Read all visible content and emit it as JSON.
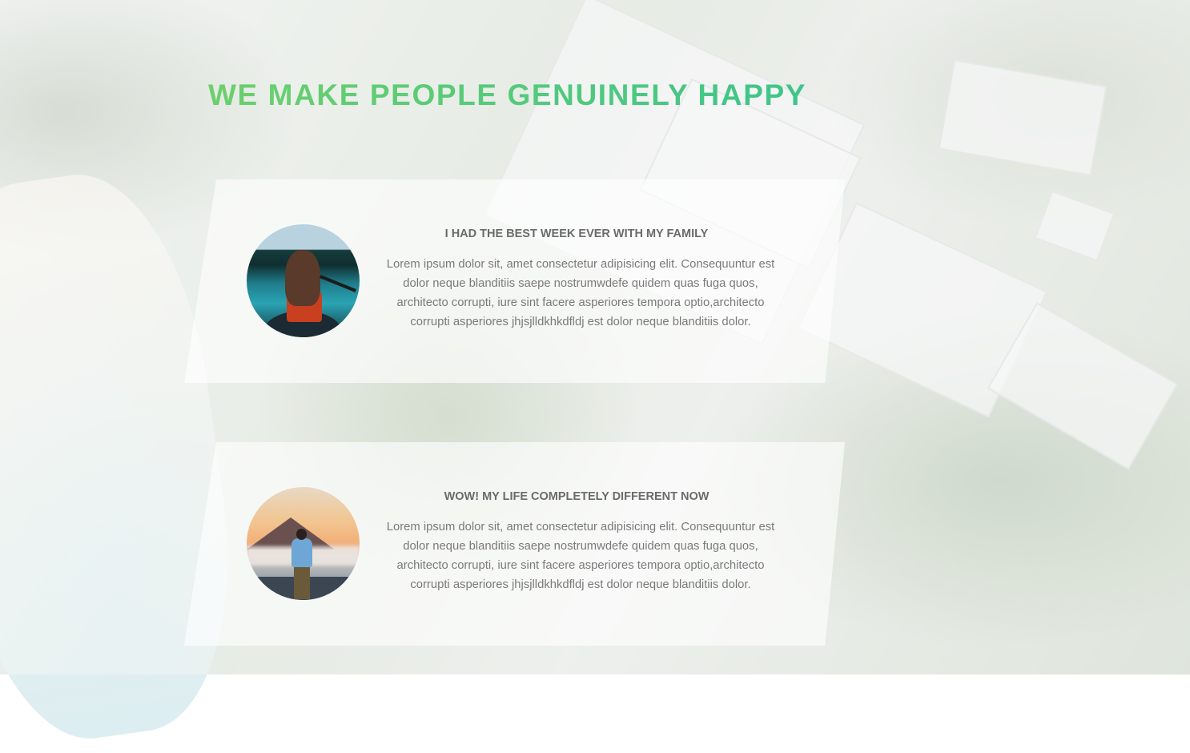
{
  "headline": "WE MAKE PEOPLE GENUINELY HAPPY",
  "testimonials": [
    {
      "title": "I HAD THE BEST WEEK EVER WITH MY FAMILY",
      "text": "Lorem ipsum dolor sit, amet consectetur adipisicing elit. Consequuntur est dolor neque blanditiis saepe nostrumwdefe quidem quas fuga quos, architecto corrupti, iure sint facere asperiores tempora optio,architecto corrupti asperiores jhjsjlldkhkdfldj est dolor neque blanditiis dolor."
    },
    {
      "title": "WOW! MY LIFE COMPLETELY DIFFERENT NOW",
      "text": "Lorem ipsum dolor sit, amet consectetur adipisicing elit. Consequuntur est dolor neque blanditiis saepe nostrumwdefe quidem quas fuga quos, architecto corrupti, iure sint facere asperiores tempora optio,architecto corrupti asperiores jhjsjlldkhkdfldj est dolor neque blanditiis dolor."
    }
  ],
  "colors": {
    "headline_gradient_start": "#6ccf6c",
    "headline_gradient_end": "#3ec58a",
    "card_title": "#6b6b6b",
    "card_text": "#7a7a7a"
  }
}
